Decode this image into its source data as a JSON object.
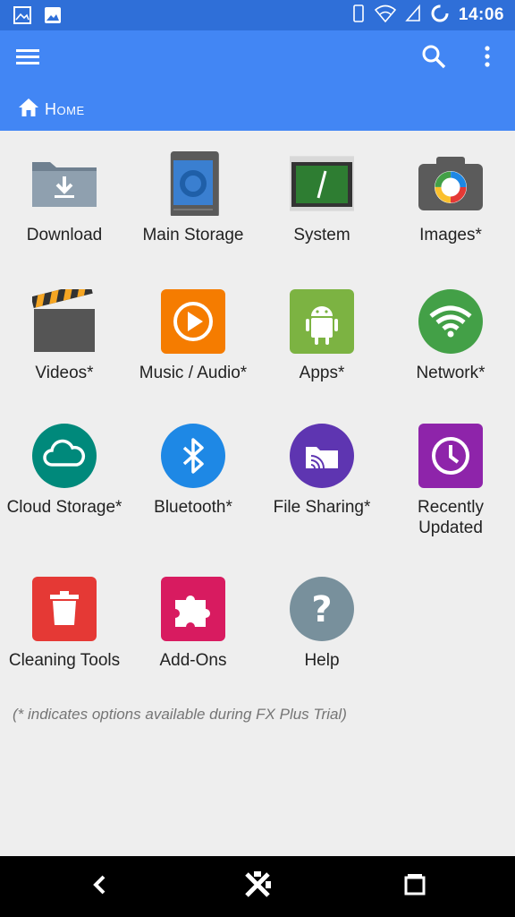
{
  "status_bar": {
    "time": "14:06",
    "left_icons": [
      "gallery-notification-icon",
      "image-notification-icon"
    ],
    "right_icons": [
      "vibrate-icon",
      "wifi-icon",
      "cell-signal-icon",
      "sync-icon"
    ]
  },
  "app_bar": {
    "breadcrumb": "Home",
    "color": "#4286f4",
    "status_color": "#2f6fd8"
  },
  "tiles": [
    {
      "label": "Download",
      "icon": "download-folder-icon"
    },
    {
      "label": "Main Storage",
      "icon": "main-storage-icon"
    },
    {
      "label": "System",
      "icon": "system-terminal-icon"
    },
    {
      "label": "Images*",
      "icon": "images-camera-icon"
    },
    {
      "label": "Videos*",
      "icon": "videos-clapper-icon"
    },
    {
      "label": "Music / Audio*",
      "icon": "music-play-icon"
    },
    {
      "label": "Apps*",
      "icon": "apps-android-icon"
    },
    {
      "label": "Network*",
      "icon": "network-wifi-icon"
    },
    {
      "label": "Cloud Storage*",
      "icon": "cloud-icon"
    },
    {
      "label": "Bluetooth*",
      "icon": "bluetooth-icon"
    },
    {
      "label": "File Sharing*",
      "icon": "file-sharing-icon"
    },
    {
      "label": "Recently Updated",
      "icon": "clock-icon"
    },
    {
      "label": "Cleaning Tools",
      "icon": "trash-icon"
    },
    {
      "label": "Add-Ons",
      "icon": "puzzle-icon"
    },
    {
      "label": "Help",
      "icon": "help-question-icon"
    }
  ],
  "footnote": "(* indicates options available during FX Plus Trial)",
  "nav_bar": {
    "icons": [
      "back-icon",
      "home-fx-icon",
      "recents-icon"
    ]
  }
}
